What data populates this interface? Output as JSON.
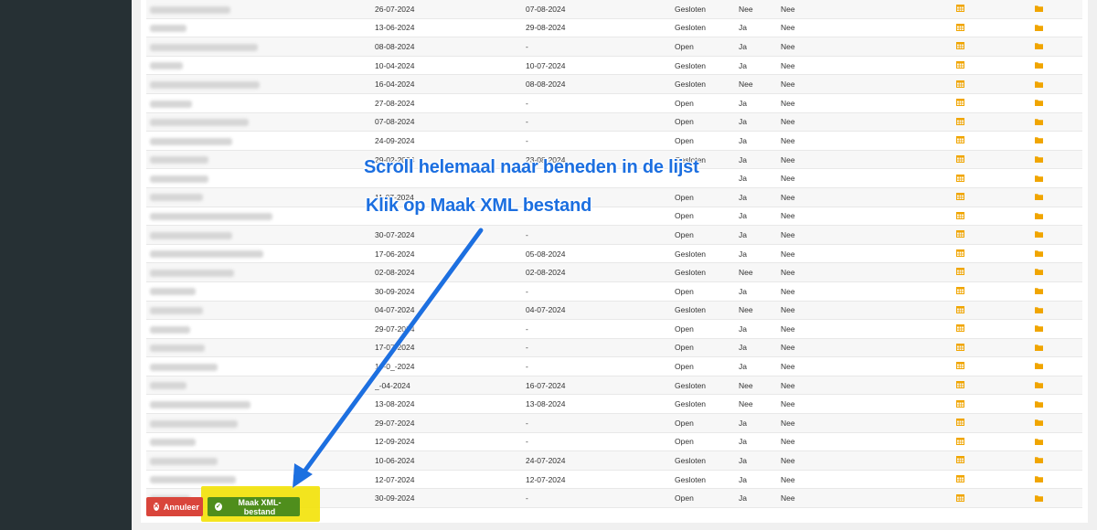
{
  "colors": {
    "sidebar": "#263034",
    "annotation": "#1c6fe0",
    "highlight": "#f3e100",
    "cancel_button": "#d9453b",
    "xml_button": "#4f8e1c",
    "icon": "#f0a500"
  },
  "rows": [
    {
      "start": "26-07-2024",
      "end": "07-08-2024",
      "status": "Gesloten",
      "yn1": "Nee",
      "yn2": "Nee"
    },
    {
      "start": "13-06-2024",
      "end": "29-08-2024",
      "status": "Gesloten",
      "yn1": "Ja",
      "yn2": "Nee"
    },
    {
      "start": "08-08-2024",
      "end": "-",
      "status": "Open",
      "yn1": "Ja",
      "yn2": "Nee"
    },
    {
      "start": "10-04-2024",
      "end": "10-07-2024",
      "status": "Gesloten",
      "yn1": "Ja",
      "yn2": "Nee"
    },
    {
      "start": "16-04-2024",
      "end": "08-08-2024",
      "status": "Gesloten",
      "yn1": "Nee",
      "yn2": "Nee"
    },
    {
      "start": "27-08-2024",
      "end": "-",
      "status": "Open",
      "yn1": "Ja",
      "yn2": "Nee"
    },
    {
      "start": "07-08-2024",
      "end": "-",
      "status": "Open",
      "yn1": "Ja",
      "yn2": "Nee"
    },
    {
      "start": "24-09-2024",
      "end": "-",
      "status": "Open",
      "yn1": "Ja",
      "yn2": "Nee"
    },
    {
      "start": "29-02-2024",
      "end": "23-08-2024",
      "status": "Gesloten",
      "yn1": "Ja",
      "yn2": "Nee"
    },
    {
      "start": "",
      "end": "",
      "status": "",
      "yn1": "Ja",
      "yn2": "Nee"
    },
    {
      "start": "11-07-2024",
      "end": "-",
      "status": "Open",
      "yn1": "Ja",
      "yn2": "Nee"
    },
    {
      "start": "",
      "end": "",
      "status": "Open",
      "yn1": "Ja",
      "yn2": "Nee"
    },
    {
      "start": "30-07-2024",
      "end": "-",
      "status": "Open",
      "yn1": "Ja",
      "yn2": "Nee"
    },
    {
      "start": "17-06-2024",
      "end": "05-08-2024",
      "status": "Gesloten",
      "yn1": "Ja",
      "yn2": "Nee"
    },
    {
      "start": "02-08-2024",
      "end": "02-08-2024",
      "status": "Gesloten",
      "yn1": "Nee",
      "yn2": "Nee"
    },
    {
      "start": "30-09-2024",
      "end": "-",
      "status": "Open",
      "yn1": "Ja",
      "yn2": "Nee"
    },
    {
      "start": "04-07-2024",
      "end": "04-07-2024",
      "status": "Gesloten",
      "yn1": "Nee",
      "yn2": "Nee"
    },
    {
      "start": "29-07-2024",
      "end": "-",
      "status": "Open",
      "yn1": "Ja",
      "yn2": "Nee"
    },
    {
      "start": "17-07-2024",
      "end": "-",
      "status": "Open",
      "yn1": "Ja",
      "yn2": "Nee"
    },
    {
      "start": "14-0_-2024",
      "end": "-",
      "status": "Open",
      "yn1": "Ja",
      "yn2": "Nee"
    },
    {
      "start": "_-04-2024",
      "end": "16-07-2024",
      "status": "Gesloten",
      "yn1": "Nee",
      "yn2": "Nee"
    },
    {
      "start": "13-08-2024",
      "end": "13-08-2024",
      "status": "Gesloten",
      "yn1": "Nee",
      "yn2": "Nee"
    },
    {
      "start": "29-07-2024",
      "end": "-",
      "status": "Open",
      "yn1": "Ja",
      "yn2": "Nee"
    },
    {
      "start": "12-09-2024",
      "end": "-",
      "status": "Open",
      "yn1": "Ja",
      "yn2": "Nee"
    },
    {
      "start": "10-06-2024",
      "end": "24-07-2024",
      "status": "Gesloten",
      "yn1": "Ja",
      "yn2": "Nee"
    },
    {
      "start": "12-07-2024",
      "end": "12-07-2024",
      "status": "Gesloten",
      "yn1": "Ja",
      "yn2": "Nee"
    },
    {
      "start": "30-09-2024",
      "end": "-",
      "status": "Open",
      "yn1": "Ja",
      "yn2": "Nee"
    }
  ],
  "buttons": {
    "cancel_label": "Annuleer",
    "xml_label": "Maak XML-bestand"
  },
  "annotations": {
    "line1": "Scroll helemaal naar beneden in de lijst",
    "line2": "Klik op Maak XML bestand"
  },
  "icons": {
    "cancel": "times-circle-icon",
    "xml": "check-circle-icon",
    "calendar": "calendar-grid-icon",
    "folder": "folder-icon"
  }
}
